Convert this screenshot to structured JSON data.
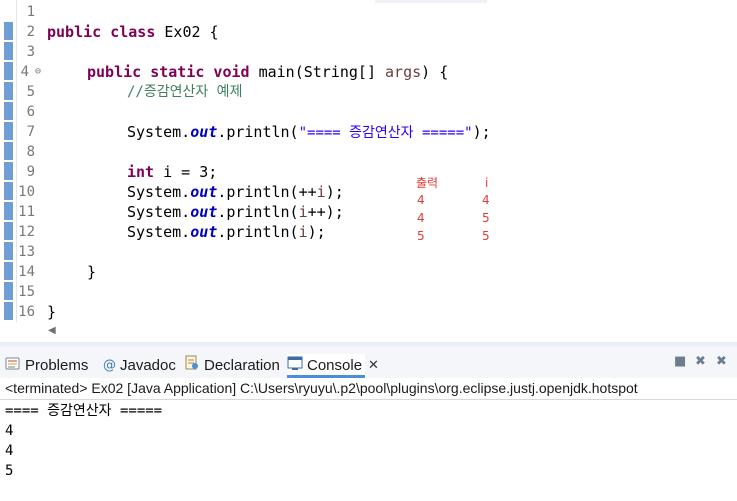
{
  "editor": {
    "line_numbers": [
      "1",
      "2",
      "3",
      "4",
      "5",
      "6",
      "7",
      "8",
      "9",
      "10",
      "11",
      "12",
      "13",
      "14",
      "15",
      "16"
    ],
    "code": {
      "l2_kw": "public class",
      "l2_rest": " Ex02 {",
      "l4_kw": "public static void",
      "l4_mid": " main(String[] ",
      "l4_var": "args",
      "l4_end": ") {",
      "l5_comment": "//증감연산자 예제",
      "l7_a": "System.",
      "l7_field": "out",
      "l7_b": ".println(",
      "l7_str": "\"==== 증감연산자 =====\"",
      "l7_end": ");",
      "l9_kw": "int",
      "l9_rest": " i = 3;",
      "l10_a": "System.",
      "l10_field": "out",
      "l10_b": ".println(++",
      "l10_var": "i",
      "l10_end": ");",
      "l11_a": "System.",
      "l11_field": "out",
      "l11_b": ".println(",
      "l11_var": "i",
      "l11_end": "++);",
      "l12_a": "System.",
      "l12_field": "out",
      "l12_b": ".println(",
      "l12_var": "i",
      "l12_end": ");",
      "l14": "}",
      "l16": "}"
    },
    "annotation": {
      "header_output": "출력",
      "header_i": "i",
      "rows": [
        [
          "4",
          "4"
        ],
        [
          "4",
          "5"
        ],
        [
          "5",
          "5"
        ]
      ]
    }
  },
  "panel": {
    "tabs": {
      "problems": "Problems",
      "javadoc": "Javadoc",
      "declaration": "Declaration",
      "console": "Console",
      "close": "✕"
    },
    "status": "<terminated> Ex02 [Java Application] C:\\Users\\ryuyu\\.p2\\pool\\plugins\\org.eclipse.justj.openjdk.hotspot",
    "output": [
      "==== 증감연산자 =====",
      "4",
      "4",
      "5"
    ]
  },
  "colors": {
    "keyword": "#7f0055",
    "comment": "#3f7f5f",
    "string": "#2a00ff",
    "field": "#0000c0",
    "annotation": "#e23b3b"
  }
}
